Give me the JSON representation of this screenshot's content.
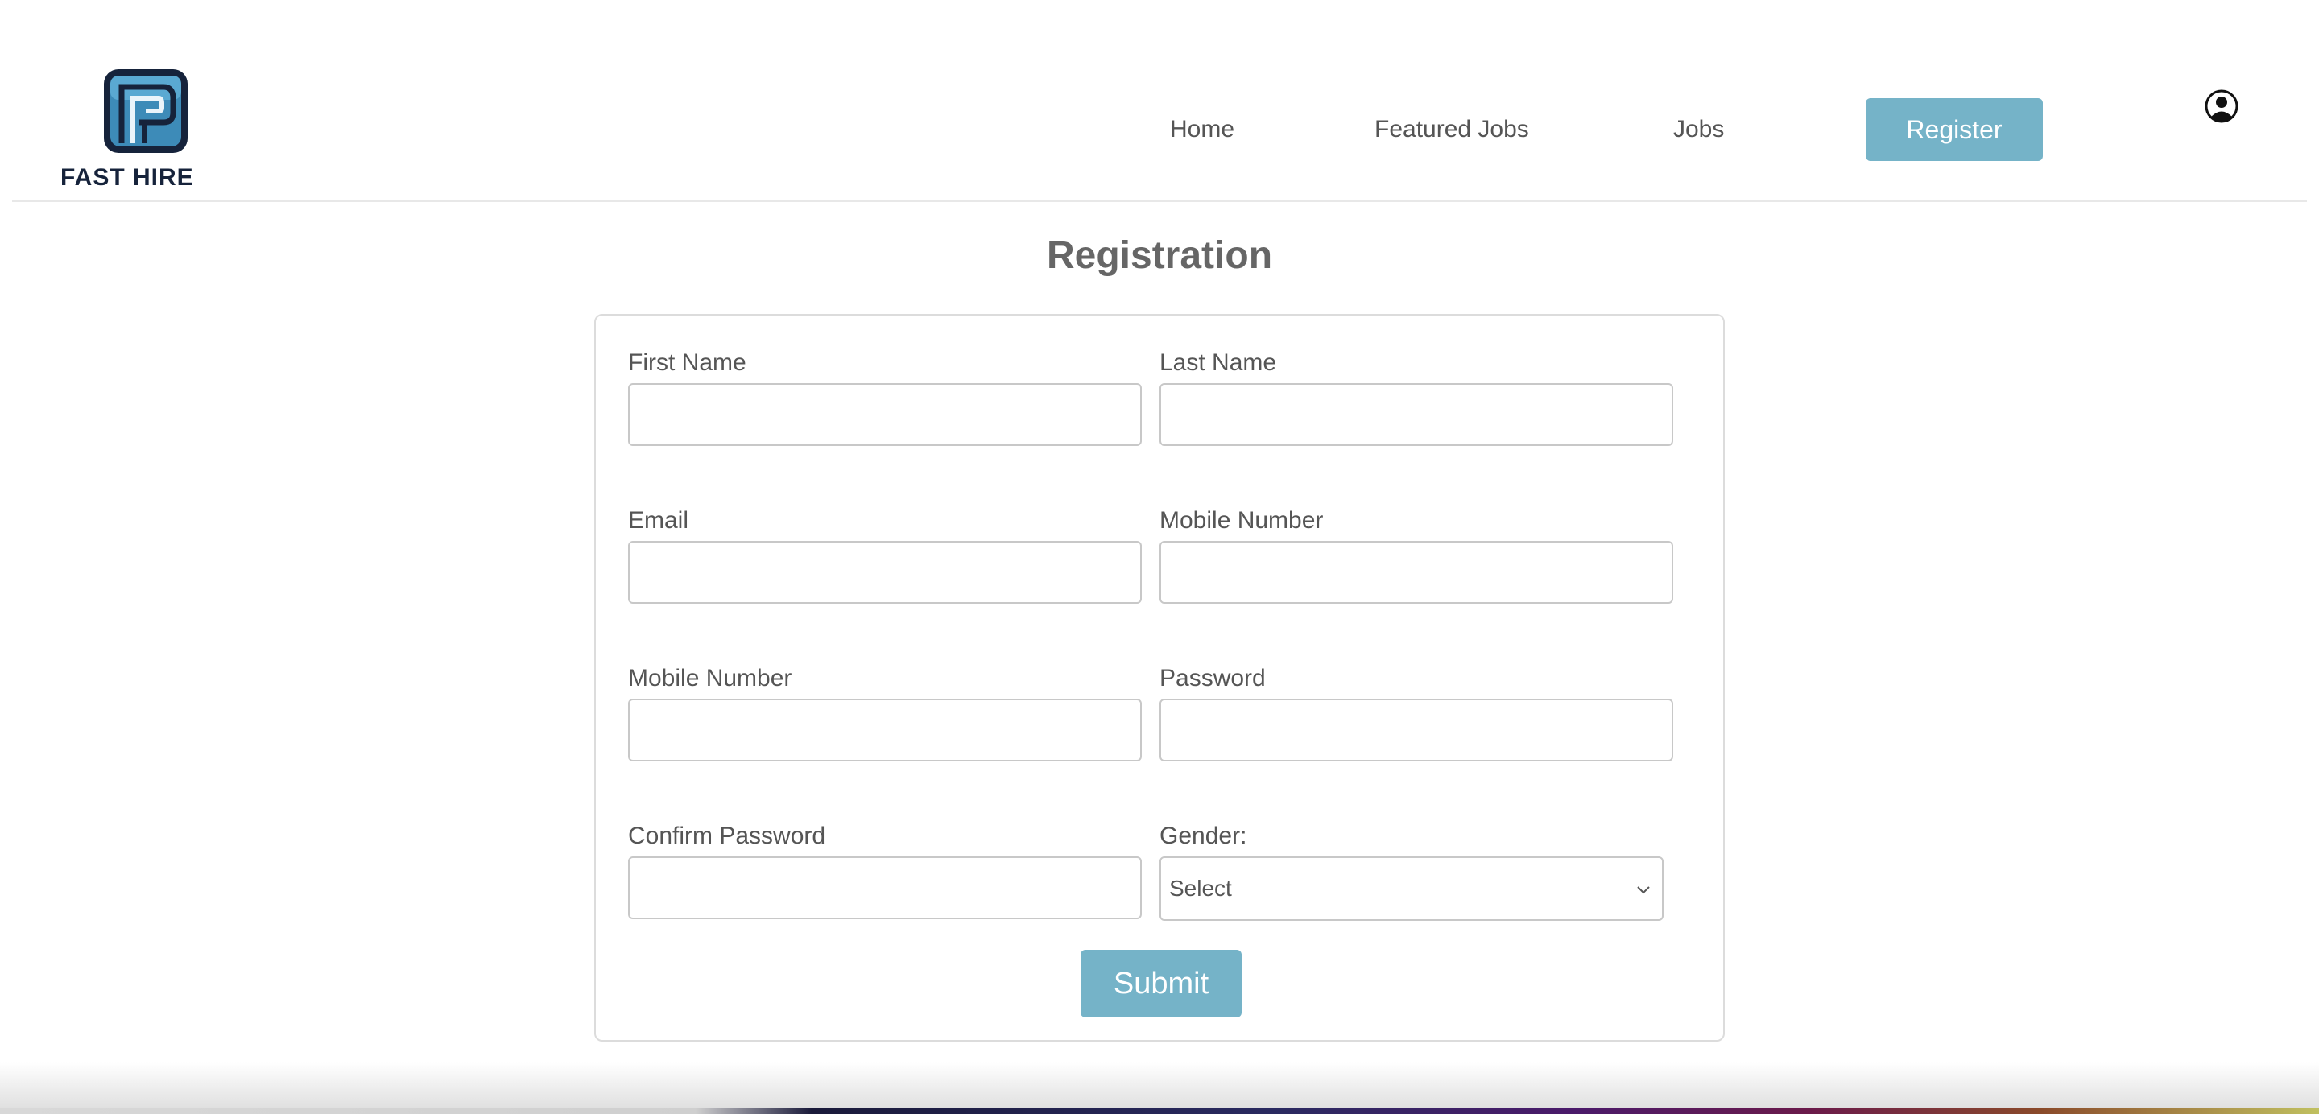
{
  "brand": {
    "name": "FAST HIRE",
    "colors": {
      "primary": "#16233b",
      "accent": "#75b3c8",
      "logo_blue": "#2f7ca6"
    }
  },
  "nav": {
    "home": "Home",
    "featured_jobs": "Featured Jobs",
    "jobs": "Jobs",
    "register": "Register",
    "user_icon": "user-circle-icon"
  },
  "page": {
    "title": "Registration"
  },
  "form": {
    "first_name": {
      "label": "First Name",
      "value": ""
    },
    "last_name": {
      "label": "Last Name",
      "value": ""
    },
    "email": {
      "label": "Email",
      "value": ""
    },
    "mobile_number": {
      "label": "Mobile Number",
      "value": ""
    },
    "mobile_number_2": {
      "label": "Mobile Number",
      "value": ""
    },
    "password": {
      "label": "Password",
      "value": ""
    },
    "confirm_password": {
      "label": "Confirm Password",
      "value": ""
    },
    "gender": {
      "label": "Gender:",
      "selected": "Select"
    },
    "submit": "Submit"
  }
}
